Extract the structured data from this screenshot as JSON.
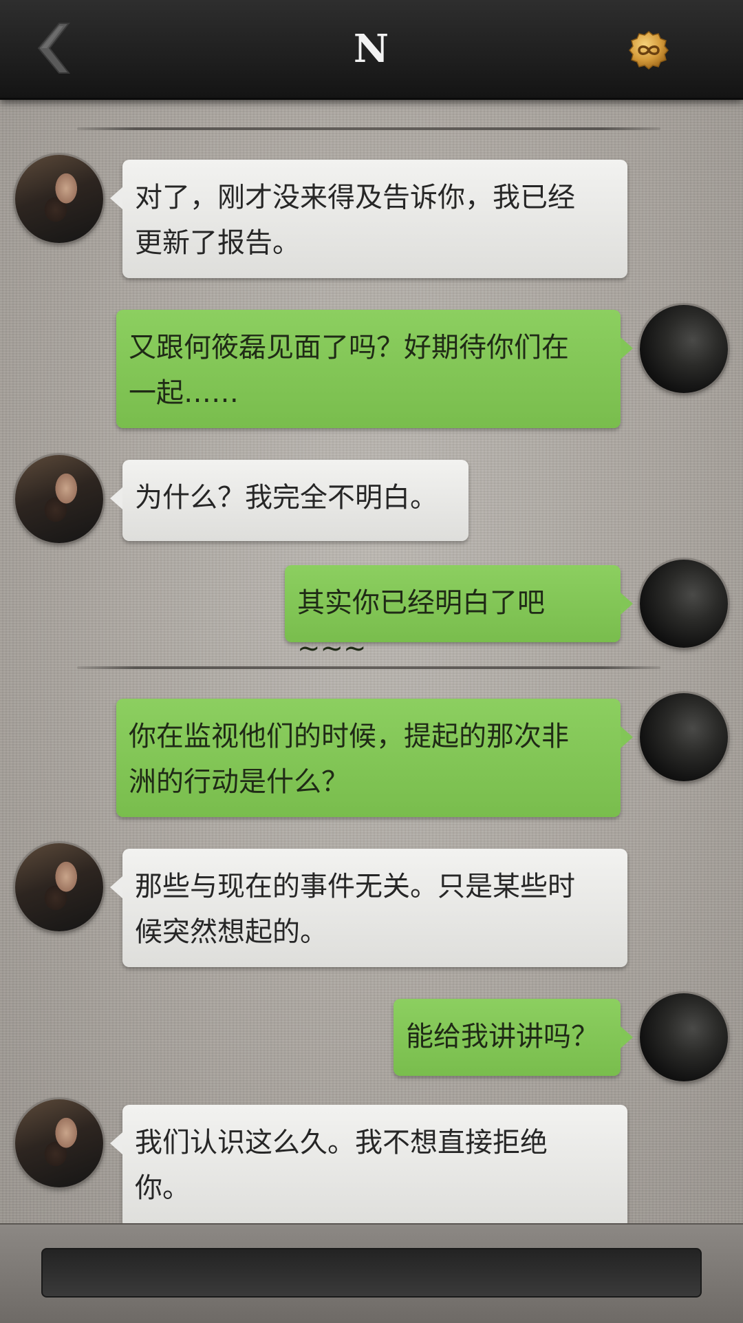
{
  "header": {
    "title": "N",
    "back_icon": "chevron-left-icon",
    "coin_icon": "infinity-coin-icon"
  },
  "colors": {
    "outgoing_bubble": "#82c657",
    "incoming_bubble": "#ececea",
    "header_bg": "#1c1c1c"
  },
  "messages": [
    {
      "side": "incoming",
      "text": "对了，刚才没来得及告诉你，我已经\n更新了报告。"
    },
    {
      "side": "outgoing",
      "text": "又跟何筱磊见面了吗？好期待你们在\n一起……"
    },
    {
      "side": "incoming",
      "text": "为什么？我完全不明白。"
    },
    {
      "side": "outgoing",
      "text": "其实你已经明白了吧~~~"
    },
    {
      "side": "outgoing",
      "text": "你在监视他们的时候，提起的那次非\n洲的行动是什么？"
    },
    {
      "side": "incoming",
      "text": "那些与现在的事件无关。只是某些时\n候突然想起的。"
    },
    {
      "side": "outgoing",
      "text": "能给我讲讲吗？"
    },
    {
      "side": "incoming",
      "text": "我们认识这么久。我不想直接拒绝\n你。"
    }
  ],
  "input": {
    "value": ""
  }
}
